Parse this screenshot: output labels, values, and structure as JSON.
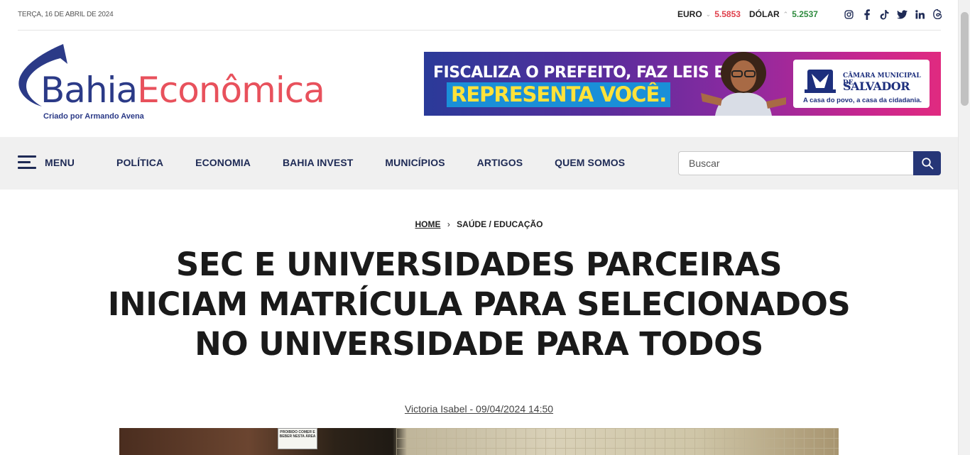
{
  "topbar": {
    "date": "TERÇA, 16 DE ABRIL DE 2024",
    "euro": {
      "label": "EURO",
      "value": "5.5853",
      "trend": "down"
    },
    "dolar": {
      "label": "DÓLAR",
      "value": "5.2537",
      "trend": "up"
    },
    "socials": [
      "instagram-icon",
      "facebook-icon",
      "tiktok-icon",
      "twitter-icon",
      "linkedin-icon",
      "threads-icon"
    ]
  },
  "logo": {
    "part1": "Bahia",
    "part2": "Econômica",
    "tagline": "Criado por Armando Avena",
    "colors": {
      "primary": "#2b3a87",
      "accent": "#e8515c"
    }
  },
  "banner": {
    "line1": "FISCALIZA O PREFEITO, FAZ LEIS E",
    "line2": "REPRESENTA VOCÊ.",
    "org_small": "CÂMARA MUNICIPAL DE",
    "org_big": "SALVADOR",
    "slogan": "A casa do povo, a casa da cidadania."
  },
  "nav": {
    "menu_label": "MENU",
    "items": [
      "POLÍTICA",
      "ECONOMIA",
      "BAHIA INVEST",
      "MUNICÍPIOS",
      "ARTIGOS",
      "QUEM SOMOS"
    ],
    "search_placeholder": "Buscar",
    "search_color": "#263677"
  },
  "article": {
    "breadcrumb": {
      "home": "HOME",
      "section": "SAÚDE / EDUCAÇÃO"
    },
    "title": "SEC E UNIVERSIDADES PARCEIRAS INICIAM MATRÍCULA PARA SELECIONADOS NO UNIVERSIDADE PARA TODOS",
    "byline": "Victoria Isabel - 09/04/2024 14:50",
    "photo_sign": "PROIBIDO COMER E BEBER NESTA ÁREA"
  }
}
